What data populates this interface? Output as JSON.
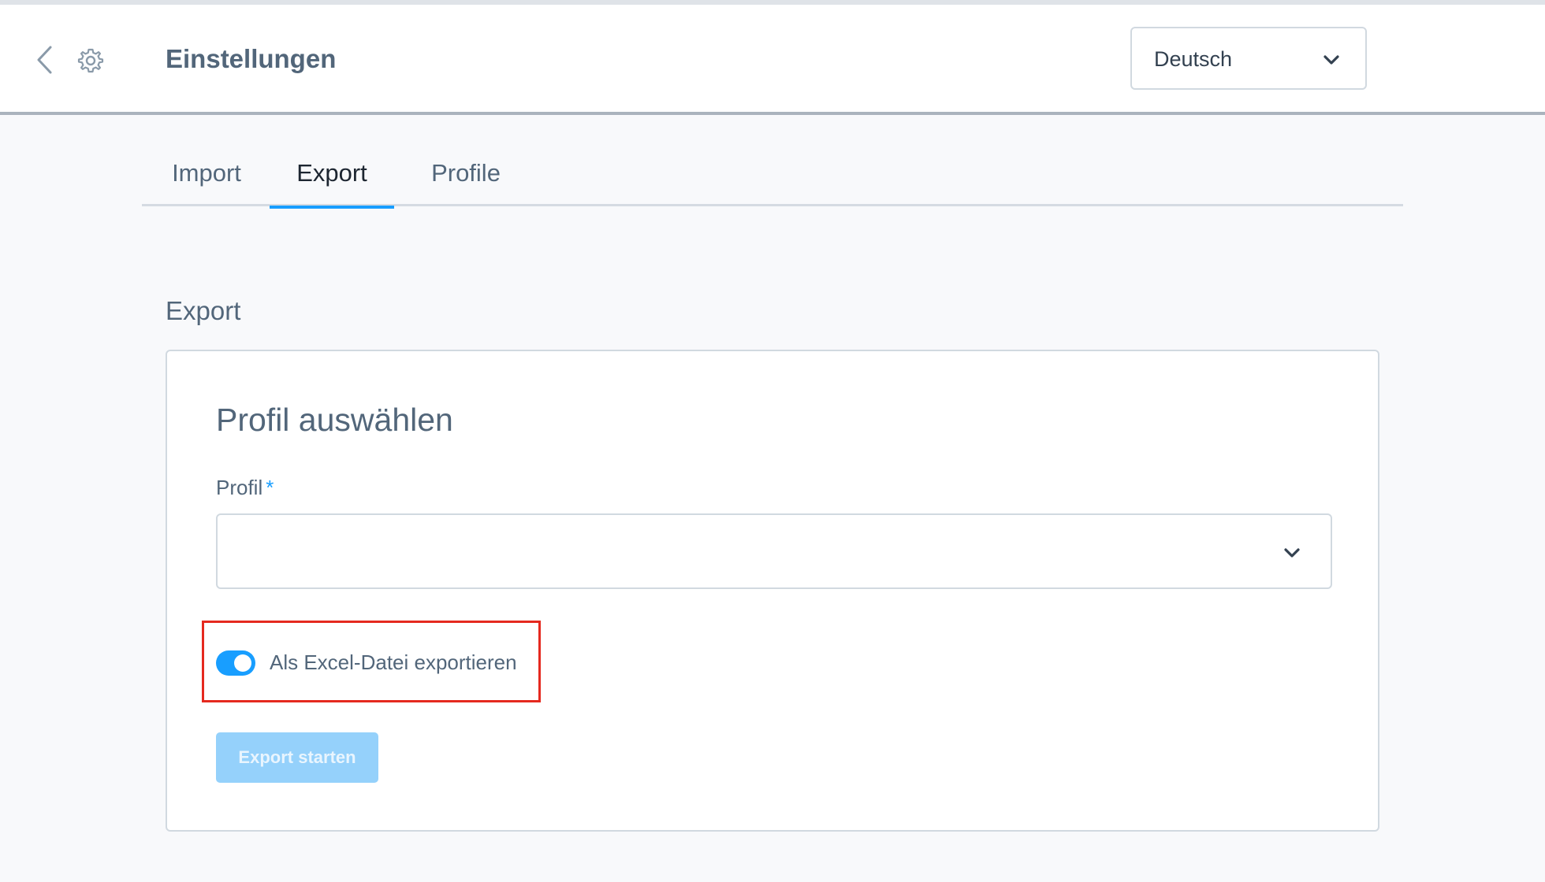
{
  "header": {
    "title": "Einstellungen",
    "language": "Deutsch",
    "icons": {
      "back": "chevron-left-icon",
      "settings": "gear-icon",
      "dropdown": "chevron-down-icon"
    }
  },
  "tabs": [
    {
      "label": "Import",
      "active": false
    },
    {
      "label": "Export",
      "active": true
    },
    {
      "label": "Profile",
      "active": false
    }
  ],
  "section": {
    "title": "Export"
  },
  "card": {
    "title": "Profil auswählen",
    "profile_label": "Profil",
    "required_marker": "*",
    "profile_value": "",
    "excel_toggle": {
      "label": "Als Excel-Datei exportieren",
      "enabled": true
    },
    "start_button": "Export starten"
  },
  "colors": {
    "accent": "#189eff",
    "highlight": "#e5291f",
    "text": "#52667a",
    "button_disabled": "#95d1fb"
  }
}
